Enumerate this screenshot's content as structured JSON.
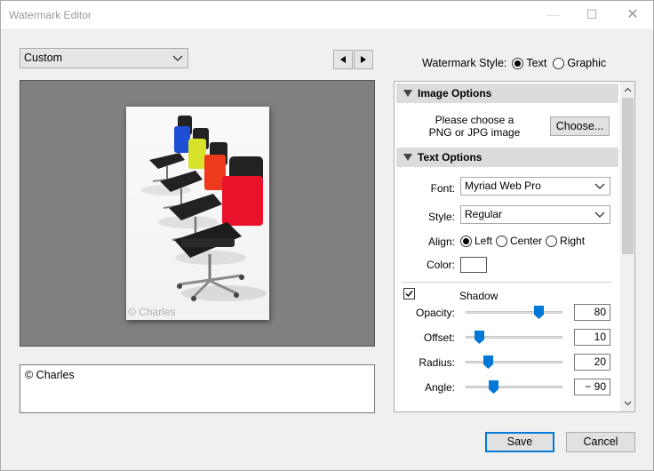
{
  "window": {
    "title": "Watermark Editor",
    "controls": {
      "minimize": "—",
      "maximize": "☐",
      "close": "✕"
    }
  },
  "toolbar": {
    "preset_value": "Custom",
    "watermark_style_label": "Watermark Style:",
    "style_options": [
      {
        "label": "Text",
        "selected": true
      },
      {
        "label": "Graphic",
        "selected": false
      }
    ]
  },
  "preview": {
    "watermark_text": "© Charles",
    "chair_colors": [
      "#1c4fd6",
      "#d8e22a",
      "#ee3a1c",
      "#e8132a"
    ]
  },
  "text_input": {
    "value": "© Charles"
  },
  "image_options": {
    "heading": "Image Options",
    "prompt_line1": "Please choose a",
    "prompt_line2": "PNG or JPG image",
    "choose_button": "Choose..."
  },
  "text_options": {
    "heading": "Text Options",
    "font_label": "Font:",
    "font_value": "Myriad Web Pro",
    "style_label": "Style:",
    "style_value": "Regular",
    "align_label": "Align:",
    "align_options": [
      {
        "label": "Left",
        "selected": true
      },
      {
        "label": "Center",
        "selected": false
      },
      {
        "label": "Right",
        "selected": false
      }
    ],
    "color_label": "Color:",
    "color_value": "#ffffff"
  },
  "shadow": {
    "label": "Shadow",
    "checked": true,
    "rows": [
      {
        "label": "Opacity:",
        "value": "80",
        "level": 0.8
      },
      {
        "label": "Offset:",
        "value": "10",
        "level": 0.1
      },
      {
        "label": "Radius:",
        "value": "20",
        "level": 0.2
      },
      {
        "label": "Angle:",
        "value": "− 90",
        "level": 0.25
      }
    ]
  },
  "footer": {
    "save_label": "Save",
    "cancel_label": "Cancel"
  }
}
